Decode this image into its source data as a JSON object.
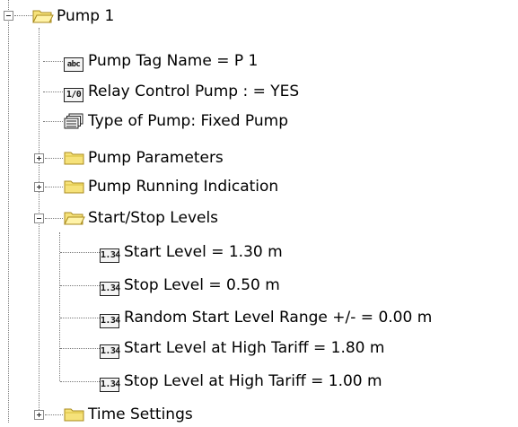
{
  "tree": {
    "root": {
      "label": "Pump 1",
      "children": {
        "tag_name": "Pump Tag Name = P 1",
        "relay": "Relay Control Pump : = YES",
        "type": "Type of Pump:  Fixed Pump",
        "parameters": "Pump Parameters",
        "running": "Pump Running Indication",
        "startstop": {
          "label": "Start/Stop Levels",
          "items": [
            "Start Level = 1.30 m",
            "Stop Level = 0.50 m",
            "Random Start Level Range +/- = 0.00 m",
            "Start Level at High Tariff = 1.80 m",
            "Stop Level at High Tariff = 1.00 m"
          ]
        },
        "time": "Time Settings"
      }
    },
    "badges": {
      "abc": "abc",
      "relay": "1/0",
      "numeric": "1.34"
    }
  },
  "colors": {
    "folder_fill": "#f6e27a",
    "folder_edge": "#a88a1c",
    "connector": "#7a7a7a"
  },
  "icons": {
    "folder_open": "folder-open-icon",
    "folder_closed": "folder-closed-icon",
    "text_value": "abc-icon",
    "boolean_value": "binary-icon",
    "list_value": "list-icon",
    "numeric_value": "numeric-icon"
  }
}
